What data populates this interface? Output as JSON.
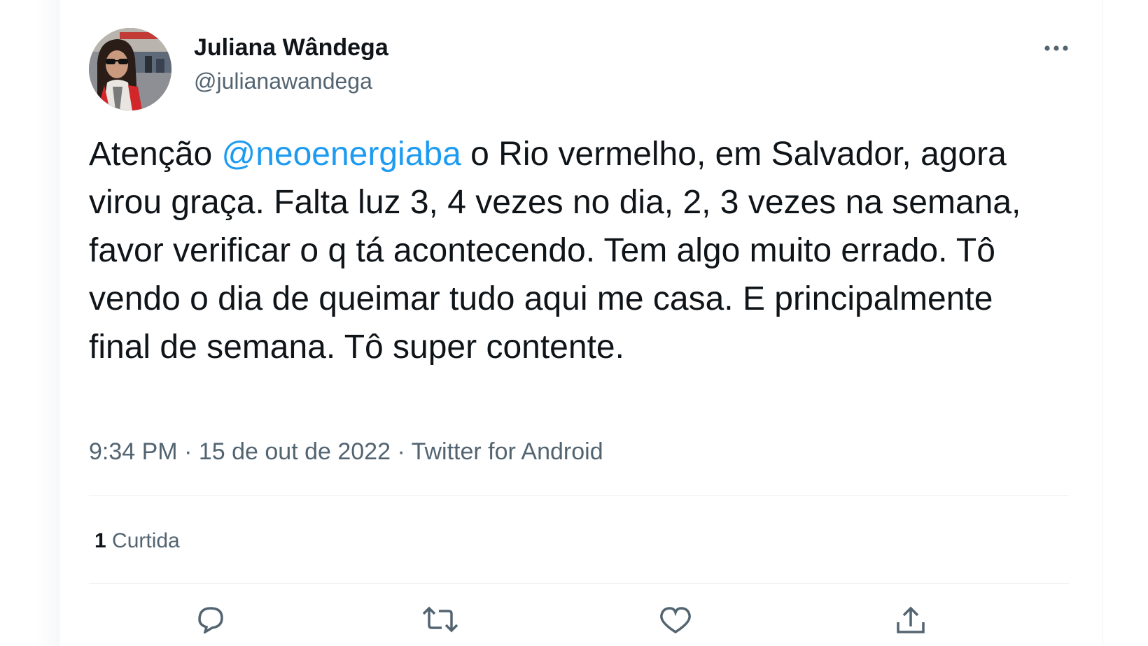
{
  "tweet": {
    "author": {
      "display_name": "Juliana Wândega",
      "handle": "@julianawandega"
    },
    "text_parts": {
      "before_mention": "Atenção ",
      "mention": "@neoenergiaba",
      "after_mention": " o Rio vermelho, em Salvador, agora virou graça. Falta luz 3, 4 vezes no dia, 2, 3 vezes na semana, favor verificar o q tá acontecendo. Tem algo muito errado. Tô vendo o dia de queimar tudo aqui me casa. E principalmente final de semana. Tô super contente."
    },
    "meta": {
      "time": "9:34 PM",
      "separator1": " · ",
      "date": "15 de out de 2022",
      "separator2": " · ",
      "source": "Twitter for Android"
    },
    "stats": {
      "likes_count": "1",
      "likes_label": "Curtida"
    },
    "icons": {
      "more": "more-horizontal-icon",
      "reply": "reply-icon",
      "retweet": "retweet-icon",
      "like": "heart-icon",
      "share": "share-icon"
    },
    "colors": {
      "text": "#0f1419",
      "secondary": "#536471",
      "accent": "#1d9bf0",
      "divider": "#eff3f4"
    }
  }
}
